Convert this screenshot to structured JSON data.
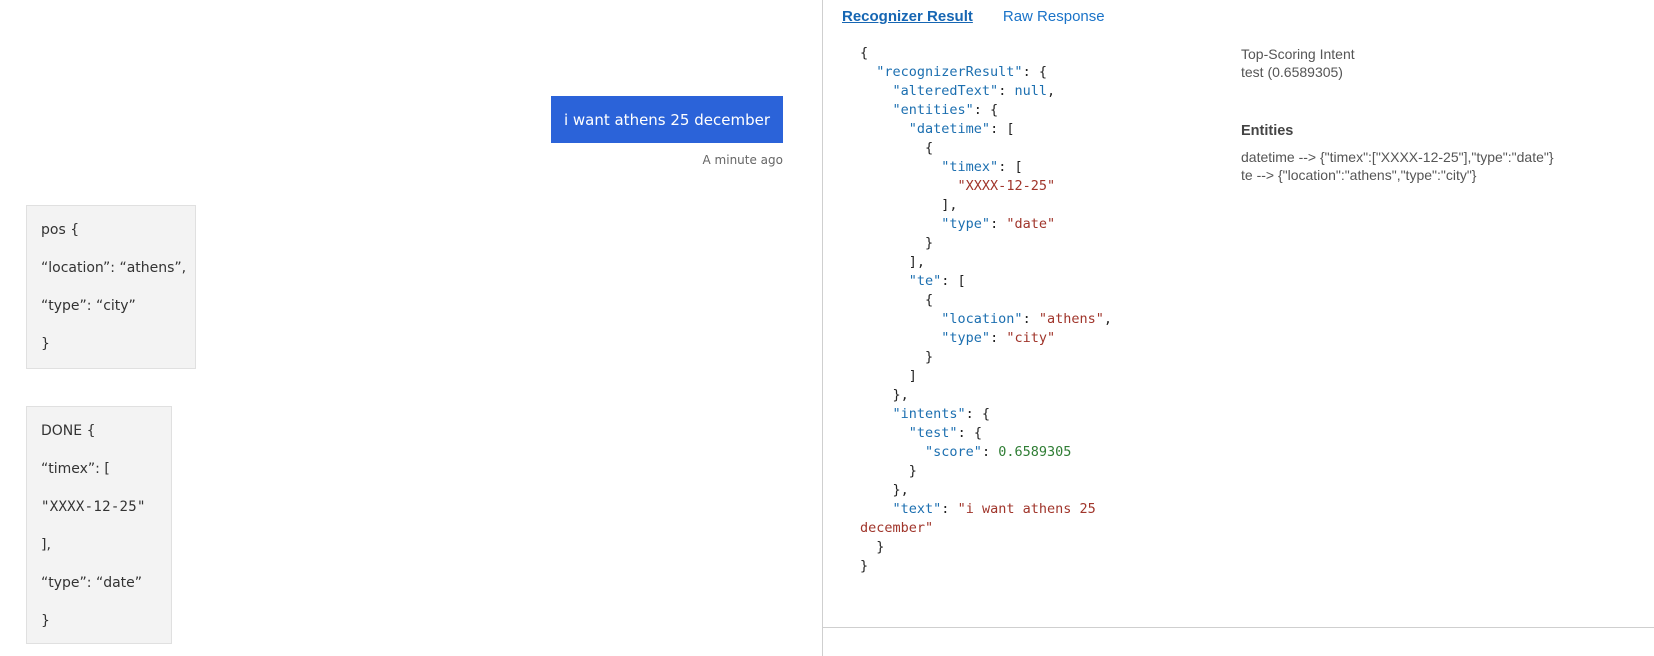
{
  "chat": {
    "user_message": "i want athens 25 december",
    "timestamp": "A minute ago",
    "bot_messages": [
      {
        "lines": [
          "pos {",
          "“location”: “athens”,",
          "“type”: “city”",
          "}"
        ]
      },
      {
        "lines": [
          "DONE {",
          "“timex”: [",
          "\"XXXX-12-25\"",
          "],",
          "“type”: “date”",
          "}"
        ]
      }
    ]
  },
  "inspector": {
    "tabs": [
      "Recognizer Result",
      "Raw Response"
    ],
    "active_tab": "Recognizer Result",
    "json_lines": [
      [
        {
          "t": "p",
          "v": "{"
        }
      ],
      [
        {
          "t": "p",
          "v": "  "
        },
        {
          "t": "k",
          "v": "\"recognizerResult\""
        },
        {
          "t": "p",
          "v": ": {"
        }
      ],
      [
        {
          "t": "p",
          "v": "    "
        },
        {
          "t": "k",
          "v": "\"alteredText\""
        },
        {
          "t": "p",
          "v": ": "
        },
        {
          "t": "l",
          "v": "null"
        },
        {
          "t": "p",
          "v": ","
        }
      ],
      [
        {
          "t": "p",
          "v": "    "
        },
        {
          "t": "k",
          "v": "\"entities\""
        },
        {
          "t": "p",
          "v": ": {"
        }
      ],
      [
        {
          "t": "p",
          "v": "      "
        },
        {
          "t": "k",
          "v": "\"datetime\""
        },
        {
          "t": "p",
          "v": ": ["
        }
      ],
      [
        {
          "t": "p",
          "v": "        {"
        }
      ],
      [
        {
          "t": "p",
          "v": "          "
        },
        {
          "t": "k",
          "v": "\"timex\""
        },
        {
          "t": "p",
          "v": ": ["
        }
      ],
      [
        {
          "t": "p",
          "v": "            "
        },
        {
          "t": "s",
          "v": "\"XXXX-12-25\""
        }
      ],
      [
        {
          "t": "p",
          "v": "          ],"
        }
      ],
      [
        {
          "t": "p",
          "v": "          "
        },
        {
          "t": "k",
          "v": "\"type\""
        },
        {
          "t": "p",
          "v": ": "
        },
        {
          "t": "s",
          "v": "\"date\""
        }
      ],
      [
        {
          "t": "p",
          "v": "        }"
        }
      ],
      [
        {
          "t": "p",
          "v": "      ],"
        }
      ],
      [
        {
          "t": "p",
          "v": "      "
        },
        {
          "t": "k",
          "v": "\"te\""
        },
        {
          "t": "p",
          "v": ": ["
        }
      ],
      [
        {
          "t": "p",
          "v": "        {"
        }
      ],
      [
        {
          "t": "p",
          "v": "          "
        },
        {
          "t": "k",
          "v": "\"location\""
        },
        {
          "t": "p",
          "v": ": "
        },
        {
          "t": "s",
          "v": "\"athens\""
        },
        {
          "t": "p",
          "v": ","
        }
      ],
      [
        {
          "t": "p",
          "v": "          "
        },
        {
          "t": "k",
          "v": "\"type\""
        },
        {
          "t": "p",
          "v": ": "
        },
        {
          "t": "s",
          "v": "\"city\""
        }
      ],
      [
        {
          "t": "p",
          "v": "        }"
        }
      ],
      [
        {
          "t": "p",
          "v": "      ]"
        }
      ],
      [
        {
          "t": "p",
          "v": "    },"
        }
      ],
      [
        {
          "t": "p",
          "v": "    "
        },
        {
          "t": "k",
          "v": "\"intents\""
        },
        {
          "t": "p",
          "v": ": {"
        }
      ],
      [
        {
          "t": "p",
          "v": "      "
        },
        {
          "t": "k",
          "v": "\"test\""
        },
        {
          "t": "p",
          "v": ": {"
        }
      ],
      [
        {
          "t": "p",
          "v": "        "
        },
        {
          "t": "k",
          "v": "\"score\""
        },
        {
          "t": "p",
          "v": ": "
        },
        {
          "t": "n",
          "v": "0.6589305"
        }
      ],
      [
        {
          "t": "p",
          "v": "      }"
        }
      ],
      [
        {
          "t": "p",
          "v": "    },"
        }
      ],
      [
        {
          "t": "p",
          "v": "    "
        },
        {
          "t": "k",
          "v": "\"text\""
        },
        {
          "t": "p",
          "v": ": "
        },
        {
          "t": "s",
          "v": "\"i want athens 25"
        }
      ],
      [
        {
          "t": "s",
          "v": "december\""
        }
      ],
      [
        {
          "t": "p",
          "v": "  }"
        }
      ],
      [
        {
          "t": "p",
          "v": "}"
        }
      ]
    ],
    "top_intent_heading": "Top-Scoring Intent",
    "top_intent_value": "test (0.6589305)",
    "entities_heading": "Entities",
    "entity_lines": [
      "datetime --> {\"timex\":[\"XXXX-12-25\"],\"type\":\"date\"}",
      "te --> {\"location\":\"athens\",\"type\":\"city\"}"
    ]
  },
  "colors": {
    "user_bubble": "#2b63d9",
    "json_key": "#1c6fb0",
    "json_string": "#a0352b",
    "json_number": "#2f7d34",
    "tab_link": "#1a73c8"
  }
}
